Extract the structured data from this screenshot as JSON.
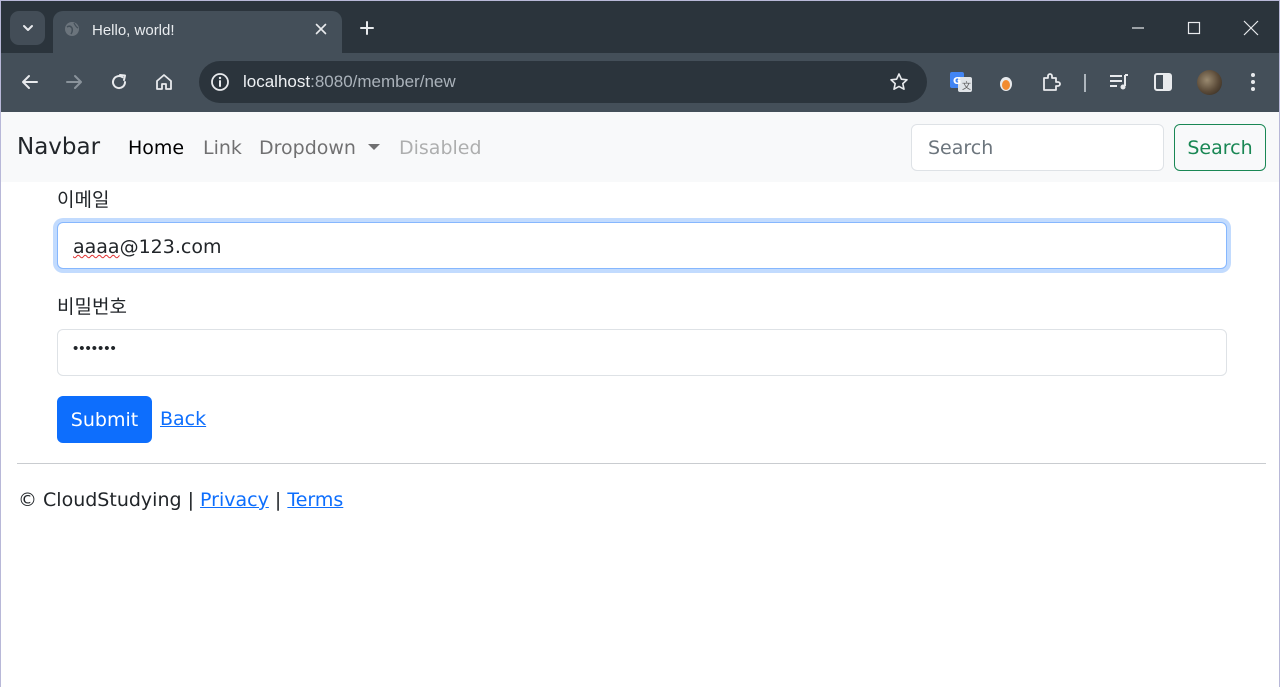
{
  "browser": {
    "tab": {
      "title": "Hello, world!"
    },
    "omnibox": {
      "host": "localhost",
      "path": ":8080/member/new"
    }
  },
  "navbar": {
    "brand": "Navbar",
    "links": [
      {
        "label": "Home"
      },
      {
        "label": "Link"
      },
      {
        "label": "Dropdown"
      },
      {
        "label": "Disabled"
      }
    ],
    "search_placeholder": "Search",
    "search_button": "Search"
  },
  "form": {
    "email_label": "이메일",
    "email_value_underlined": "aaaa",
    "email_value_rest": "@123.com",
    "password_label": "비밀번호",
    "password_mask": "•••••••",
    "submit_label": "Submit",
    "back_label": "Back"
  },
  "footer": {
    "copyright": "© CloudStudying |",
    "privacy": "Privacy",
    "separator": "|",
    "terms": "Terms"
  },
  "colors": {
    "primary": "#0d6efd",
    "success": "#198754",
    "chrome_dark": "#2b343c",
    "chrome_toolbar": "#444f59"
  }
}
